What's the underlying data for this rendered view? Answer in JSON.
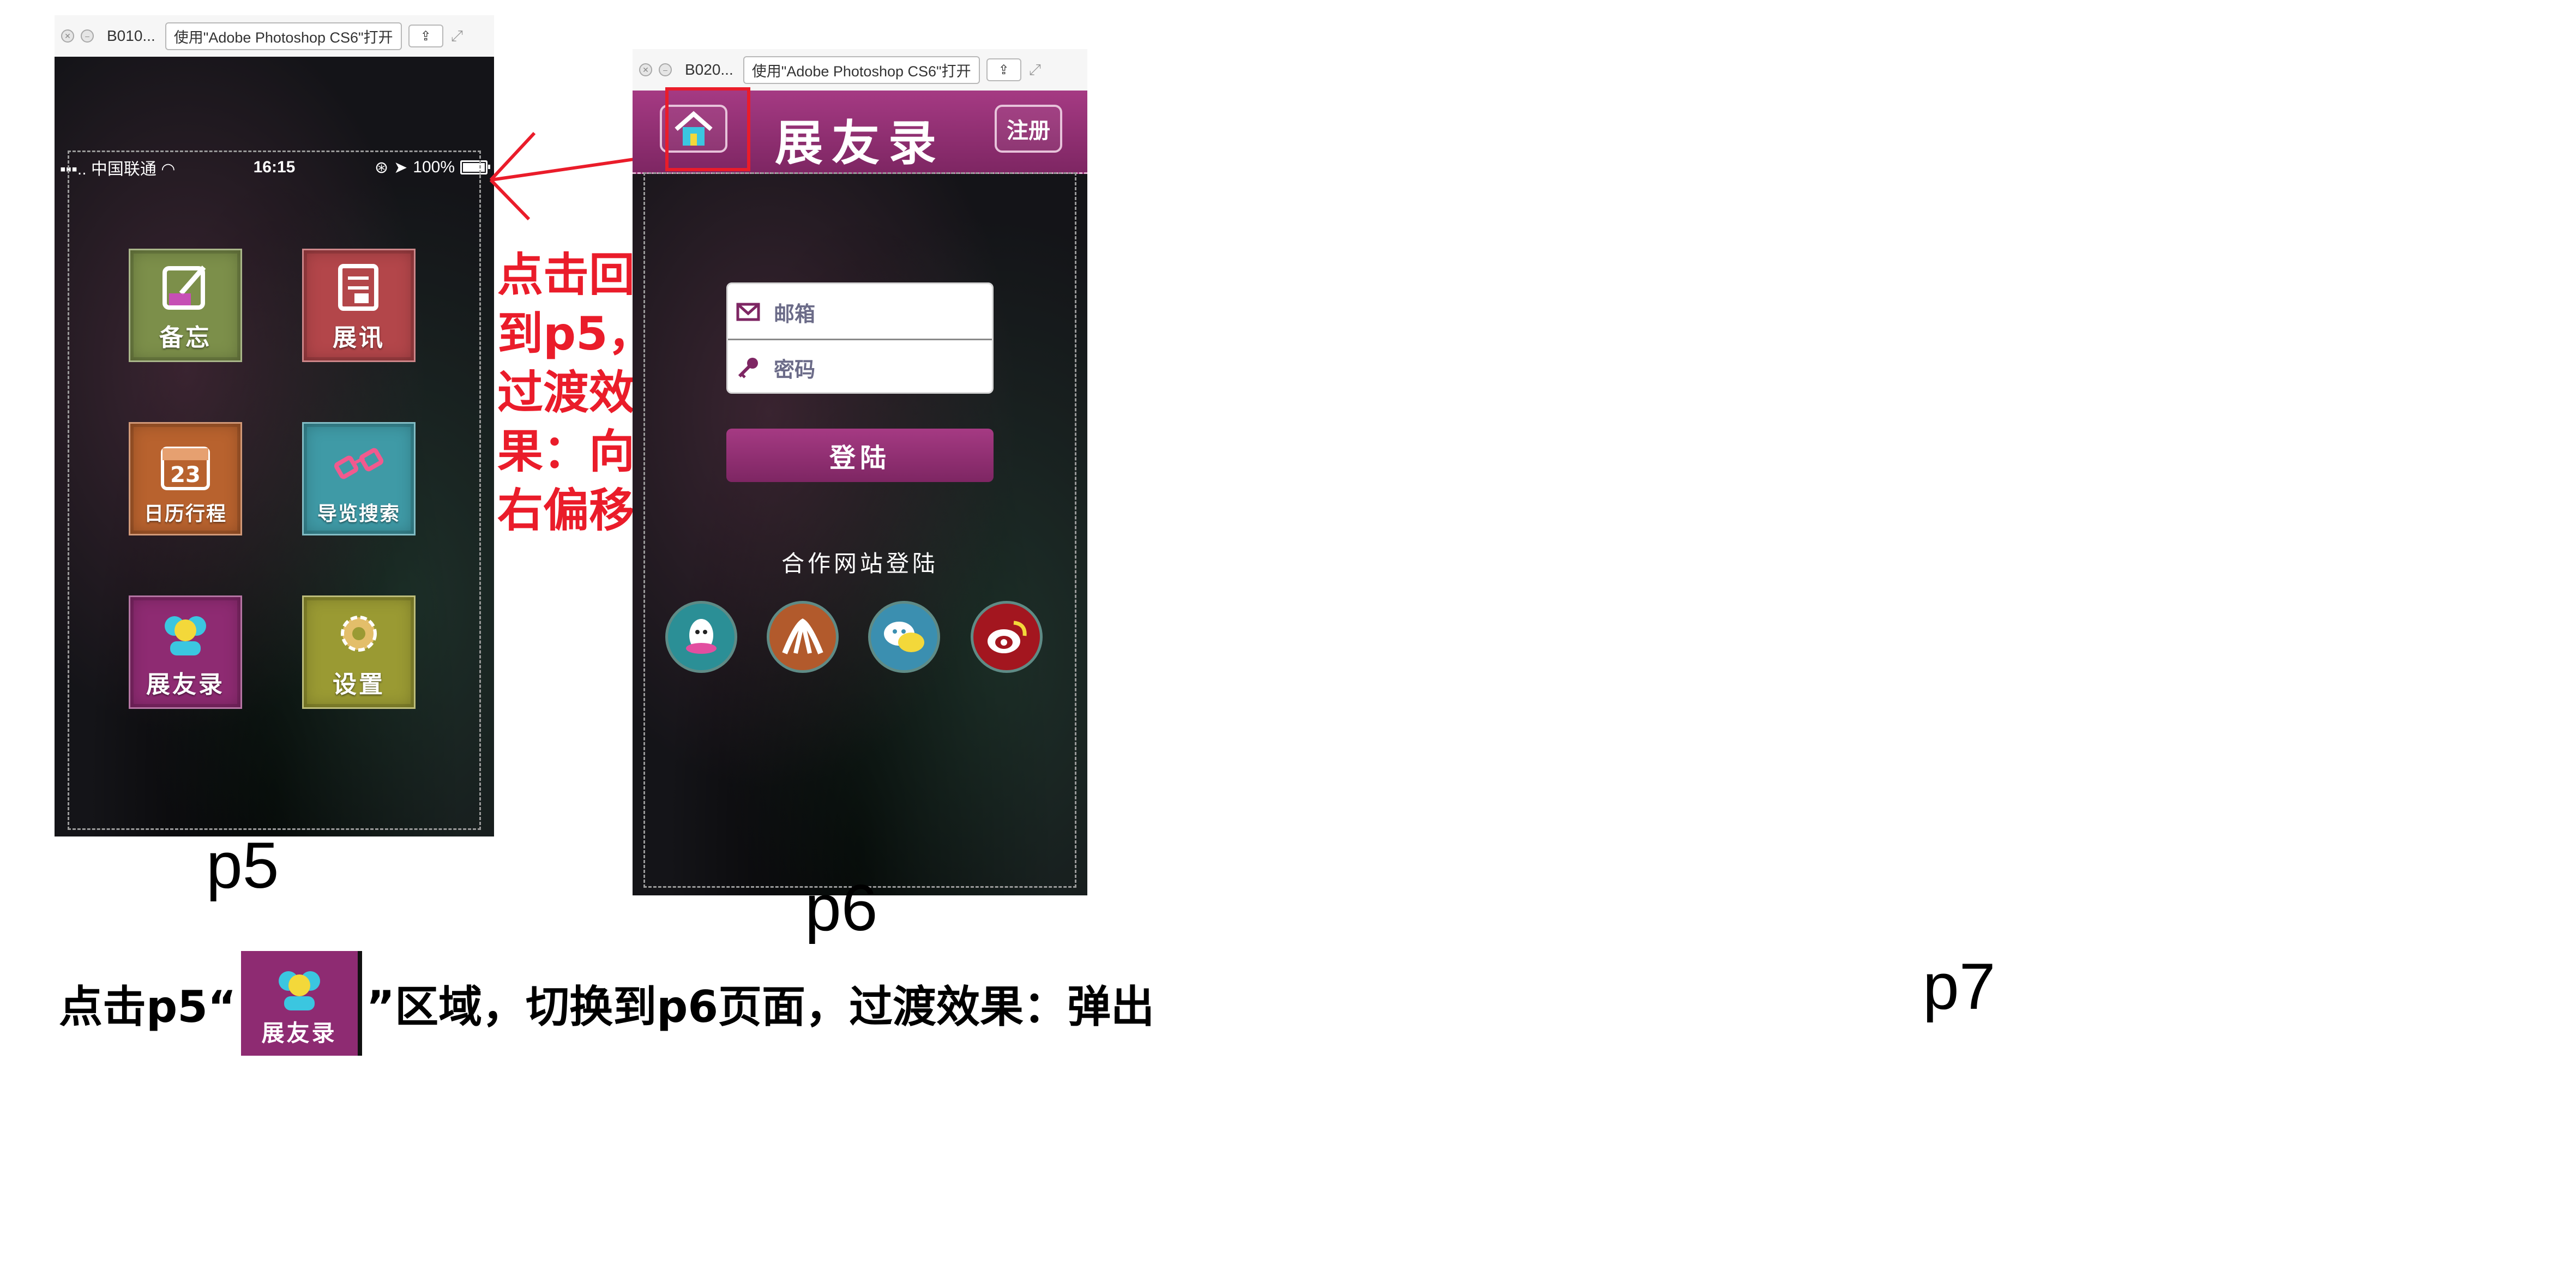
{
  "p5_window": {
    "filename": "B010...",
    "open_with": "使用\"Adobe Photoshop CS6\"打开"
  },
  "p6_window": {
    "filename": "B020...",
    "open_with": "使用\"Adobe Photoshop CS6\"打开"
  },
  "p5_status": {
    "carrier": "中国联通",
    "time": "16:15",
    "battery": "100%"
  },
  "p5_tiles": {
    "memo": "备忘",
    "news": "展讯",
    "calendar": "日历行程",
    "calendar_day": "23",
    "guide_search": "导览搜索",
    "contacts": "展友录",
    "settings": "设置"
  },
  "p6_header": {
    "title": "展友录",
    "register": "注册"
  },
  "p6_form": {
    "email_placeholder": "邮箱",
    "password_placeholder": "密码",
    "login_button": "登陆"
  },
  "p6_partner": {
    "label": "合作网站登陆"
  },
  "annotation_side": [
    "点击回",
    "到p5，",
    "过渡效",
    "果：向",
    "右偏移"
  ],
  "page_labels": {
    "p5": "p5",
    "p6": "p6",
    "p7": "p7"
  },
  "instruction": {
    "before": "点击p5“",
    "after": "”区域，切换到p6页面，过渡效果：弹出",
    "thumb_label": "展友录"
  },
  "colors": {
    "accent_magenta": "#8e2b72",
    "annotation_red": "#ea1c2a"
  }
}
